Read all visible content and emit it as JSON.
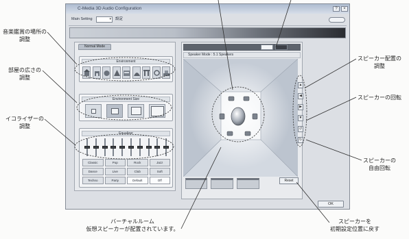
{
  "callouts": {
    "environment_location": {
      "line1": "音楽鑑賞の場所の",
      "line2": "調整"
    },
    "room_size": {
      "line1": "部屋の広さの",
      "line2": "調整"
    },
    "equalizer": {
      "line1": "イコライザーの",
      "line2": "調整"
    },
    "speaker_layout": {
      "line1": "スピーカー配置の",
      "line2": "調整"
    },
    "speaker_rotation": {
      "line1": "スピーカーの回転"
    },
    "speaker_free_rotation": {
      "line1": "スピーカーの",
      "line2": "自由回転"
    },
    "virtual_room": {
      "line1": "バーチャルルーム",
      "line2": "仮想スピーカーが配置されています。"
    },
    "speaker_reset": {
      "line1": "スピーカーを",
      "line2": "初期設定位置に戻す"
    }
  },
  "window": {
    "title": "C-Media 3D Audio Configuration",
    "title_buttons": {
      "help": "?",
      "close": "×"
    },
    "toolbar": {
      "label": "Main Setting",
      "select_value": "",
      "select_icon": "chevron-down-icon",
      "setting_label": "設定"
    },
    "left_panel": {
      "tab": "Normal Mode",
      "environment": {
        "header": "Environment",
        "icon": "environment-preset-icon"
      },
      "room_size": {
        "header": "Environment Size",
        "icon": "room-size-icon"
      },
      "equalizer": {
        "header": "Equalizer",
        "levels": [
          0.5,
          0.5,
          0.5,
          0.5,
          0.5,
          0.5,
          0.5,
          0.5,
          0.5,
          0.5
        ],
        "presets": [
          "Classic",
          "Pop",
          "Rock",
          "Jazz",
          "Dance",
          "Live",
          "Club",
          "Soft",
          "Techno",
          "Party",
          "Default",
          "Off"
        ]
      }
    },
    "right_panel": {
      "speaker_mode": "Speaker Mode : 5.1 Speakers",
      "listener_icon": "listener-icon",
      "speaker_icon": "virtual-speaker-icon",
      "side_controls": [
        {
          "icon": "arrow-up-icon",
          "glyph": "▲"
        },
        {
          "icon": "arrow-left-icon",
          "glyph": "◀"
        },
        {
          "icon": "arrow-right-icon",
          "glyph": "▶"
        },
        {
          "icon": "arrow-down-icon",
          "glyph": "▼"
        },
        {
          "icon": "rotate-left-icon",
          "glyph": "↺"
        },
        {
          "icon": "rotate-right-icon",
          "glyph": "↻"
        }
      ],
      "reset_label": "Reset"
    },
    "ok_label": "OK"
  },
  "colors": {
    "title_bar": "#aebcd0",
    "band_dark": "#2a2c31",
    "panel": "#e9ebee",
    "annotation_line": "#333333"
  }
}
